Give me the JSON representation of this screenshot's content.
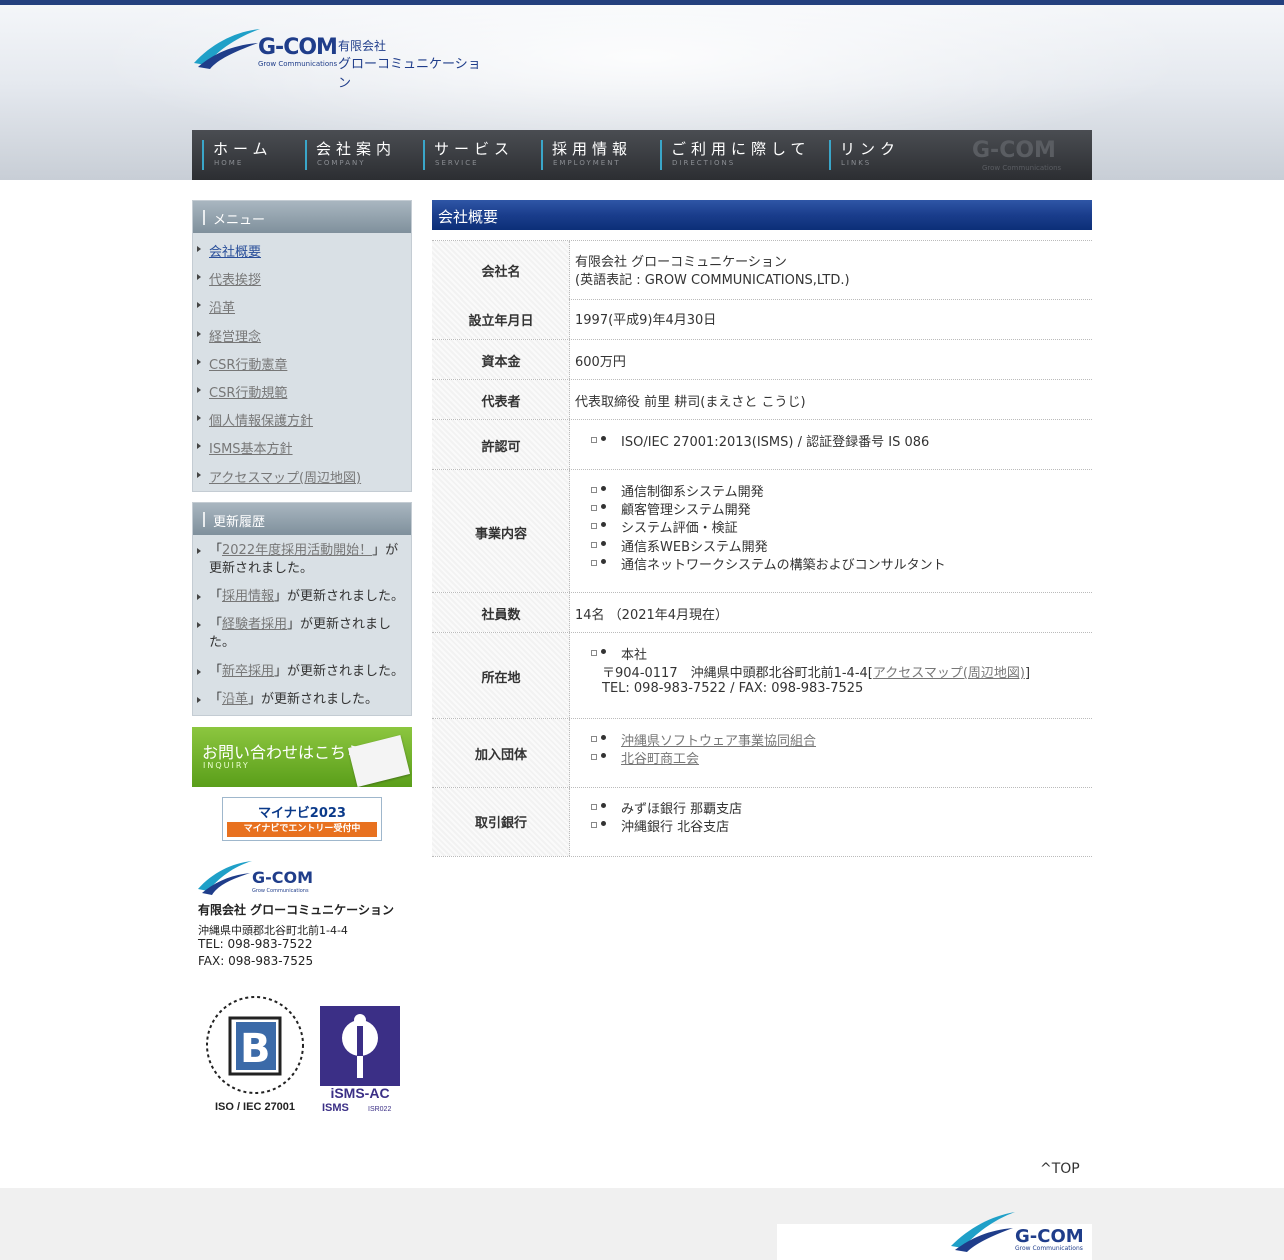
{
  "header": {
    "logo_text": "G-COM",
    "logo_sub": "Grow Communications",
    "logo_jp_line1": "有限会社",
    "logo_jp_line2": "グローコミュニケーション"
  },
  "nav": [
    {
      "jp": "ホーム",
      "en": "HOME"
    },
    {
      "jp": "会社案内",
      "en": "COMPANY"
    },
    {
      "jp": "サービス",
      "en": "SERVICE"
    },
    {
      "jp": "採用情報",
      "en": "EMPLOYMENT"
    },
    {
      "jp": "ご利用に際して",
      "en": "DIRECTIONS"
    },
    {
      "jp": "リンク",
      "en": "LINKS"
    }
  ],
  "sidebar": {
    "menu_title": "メニュー",
    "menu": [
      "会社概要",
      "代表挨拶",
      "沿革",
      "経営理念",
      "CSR行動憲章",
      "CSR行動規範",
      "個人情報保護方針",
      "ISMS基本方針",
      "アクセスマップ(周辺地図)"
    ],
    "updates_title": "更新履歴",
    "updates": [
      {
        "pre": "「",
        "link": "2022年度採用活動開始！",
        "post": "」が更新されました。"
      },
      {
        "pre": "「",
        "link": "採用情報",
        "post": "」が更新されました。"
      },
      {
        "pre": "「",
        "link": "経験者採用",
        "post": "」が更新されました。"
      },
      {
        "pre": "「",
        "link": "新卒採用",
        "post": "」が更新されました。"
      },
      {
        "pre": "「",
        "link": "沿革",
        "post": "」が更新されました。"
      }
    ],
    "inquiry_title": "お問い合わせはこちら",
    "inquiry_sub": "INQUIRY",
    "mynavi_top": "マイナビ2023",
    "mynavi_bottom": "マイナビでエントリー受付中",
    "company": "有限会社 グローコミュニケーション",
    "address": "沖縄県中頭郡北谷町北前1-4-4",
    "tel": "TEL: 098-983-7522",
    "fax": "FAX: 098-983-7525",
    "cert_lb_label": "ISO / IEC 27001",
    "cert_isms_label1": "iSMS-AC",
    "cert_isms_label2": "ISMS",
    "cert_isms_code": "ISR022"
  },
  "main": {
    "title": "会社概要",
    "rows": {
      "name_label": "会社名",
      "name_line1": "有限会社 グローコミュニケーション",
      "name_line2": "(英語表記 : GROW COMMUNICATIONS,LTD.)",
      "founded_label": "設立年月日",
      "founded": "1997(平成9)年4月30日",
      "capital_label": "資本金",
      "capital": "600万円",
      "rep_label": "代表者",
      "rep": "代表取締役 前里 耕司(まえさと こうじ)",
      "license_label": "許認可",
      "license": "ISO/IEC 27001:2013(ISMS) / 認証登録番号 IS 086",
      "business_label": "事業内容",
      "business": [
        "通信制御系システム開発",
        "顧客管理システム開発",
        "システム評価・検証",
        "通信系WEBシステム開発",
        "通信ネットワークシステムの構築およびコンサルタント"
      ],
      "employees_label": "社員数",
      "employees": "14名 （2021年4月現在）",
      "location_label": "所在地",
      "location_head": "本社",
      "location_addr": "〒904-0117　沖縄県中頭郡北谷町北前1-4-4",
      "location_link": "アクセスマップ(周辺地図)",
      "location_tel": "TEL: 098-983-7522 / FAX: 098-983-7525",
      "orgs_label": "加入団体",
      "orgs": [
        "沖縄県ソフトウェア事業協同組合",
        "北谷町商工会"
      ],
      "banks_label": "取引銀行",
      "banks": [
        "みずほ銀行 那覇支店",
        "沖縄銀行 北谷支店"
      ]
    }
  },
  "footer": {
    "totop": "^TOP"
  },
  "colors": {
    "accent_blue": "#1a3d8c",
    "nav_bg": "#2c2e32",
    "sidebar_bg": "#d9e0e5",
    "inquiry_green": "#6fb22a"
  }
}
